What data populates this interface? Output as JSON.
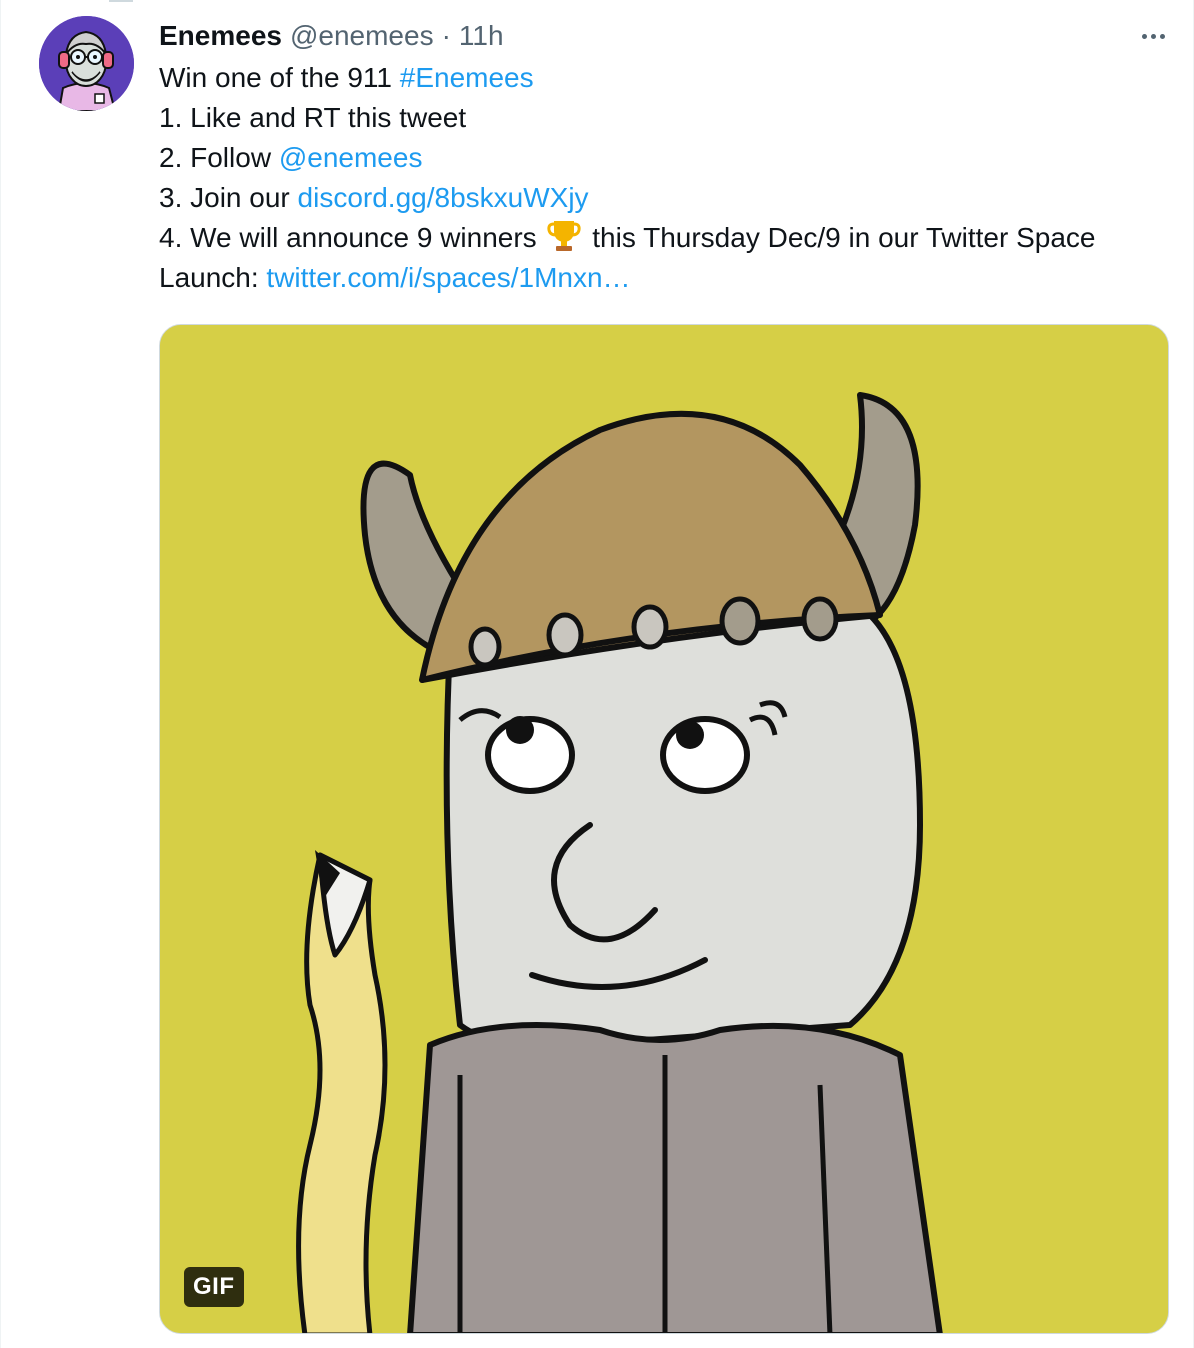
{
  "tweet": {
    "display_name": "Enemees",
    "handle": "@enemees",
    "separator": "·",
    "time": "11h",
    "lines": {
      "l1_text": "Win one of the 911 ",
      "l1_hashtag": "#Enemees",
      "l2_text": "1. Like and RT this tweet",
      "l3_text": "2. Follow ",
      "l3_mention": "@enemees",
      "l4_text": "3. Join our ",
      "l4_link": "discord.gg/8bskxuWXjy",
      "l5_text_before": "4. We will announce 9 winners",
      "l5_text_after": " this Thursday Dec/9 in our Twitter Space",
      "l6_text": "Launch: ",
      "l6_link": "twitter.com/i/spaces/1Mnxn…"
    },
    "media": {
      "badge": "GIF"
    }
  },
  "icons": {
    "more": "more-horizontal-icon",
    "trophy": "trophy-emoji-icon"
  },
  "colors": {
    "link": "#1d9bf0",
    "secondary_text": "#536471",
    "primary_text": "#0f1419",
    "gif_background": "#d6cf46"
  }
}
